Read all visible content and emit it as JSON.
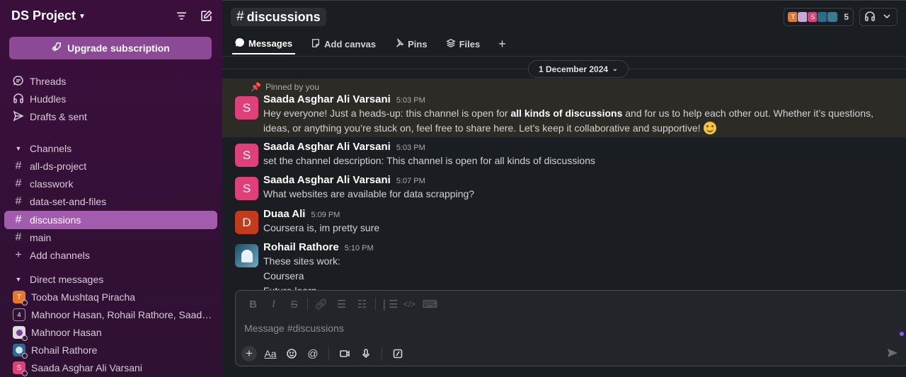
{
  "workspace": {
    "name": "DS Project"
  },
  "sidebar": {
    "upgrade_label": "Upgrade subscription",
    "nav": [
      {
        "label": "Threads",
        "icon": "threads-icon"
      },
      {
        "label": "Huddles",
        "icon": "headphones-icon"
      },
      {
        "label": "Drafts & sent",
        "icon": "send-icon"
      }
    ],
    "channels_heading": "Channels",
    "channels": [
      "all-ds-project",
      "classwork",
      "data-set-and-files",
      "discussions",
      "main"
    ],
    "active_channel": "discussions",
    "add_channels": "Add channels",
    "dm_heading": "Direct messages",
    "dms": [
      {
        "name": "Tooba Mushtaq Piracha",
        "initial": "T",
        "color": "#e8772e"
      },
      {
        "name": "Mahnoor Hasan, Rohail Rathore, Saada…",
        "initial": "4",
        "color": "#9a9a9a"
      },
      {
        "name": "Mahnoor Hasan",
        "initial": "",
        "color": "#c9a6d9"
      },
      {
        "name": "Rohail Rathore",
        "initial": "",
        "color": "#2d6b8c"
      },
      {
        "name": "Saada Asghar Ali Varsani",
        "initial": "S",
        "color": "#e0407a"
      }
    ]
  },
  "header": {
    "channel_name": "discussions",
    "member_count": "5",
    "tabs": [
      {
        "label": "Messages",
        "icon": "message-icon"
      },
      {
        "label": "Add canvas",
        "icon": "canvas-icon"
      },
      {
        "label": "Pins",
        "icon": "pin-icon"
      },
      {
        "label": "Files",
        "icon": "files-icon"
      }
    ]
  },
  "date_divider": "1 December 2024",
  "pinned_label": "Pinned by you",
  "messages": [
    {
      "author": "Saada Asghar Ali Varsani",
      "time": "5:03 PM",
      "initial": "S",
      "color": "#e0407a",
      "text_pre": "Hey everyone! Just a heads-up: this channel is open for ",
      "text_bold": "all kinds of discussions",
      "text_post": " and for us to help each other out. Whether it’s questions, ideas, or anything you’re stuck on, feel free to share here. Let’s keep it collaborative and supportive! "
    },
    {
      "author": "Saada Asghar Ali Varsani",
      "time": "5:03 PM",
      "initial": "S",
      "color": "#e0407a",
      "text": "set the channel description: This channel is open for all kinds of discussions"
    },
    {
      "author": "Saada Asghar Ali Varsani",
      "time": "5:07 PM",
      "initial": "S",
      "color": "#e0407a",
      "text": "What websites are available for data scrapping?"
    },
    {
      "author": "Duaa Ali",
      "time": "5:09 PM",
      "initial": "D",
      "color": "#c23b1c",
      "text": "Coursera is, im pretty sure"
    },
    {
      "author": "Rohail Rathore",
      "time": "5:10 PM",
      "initial": "",
      "color": "#2d6b8c",
      "lines": [
        "These sites work:",
        "Coursera",
        "Future learn"
      ]
    }
  ],
  "composer": {
    "placeholder": "Message #discussions"
  }
}
